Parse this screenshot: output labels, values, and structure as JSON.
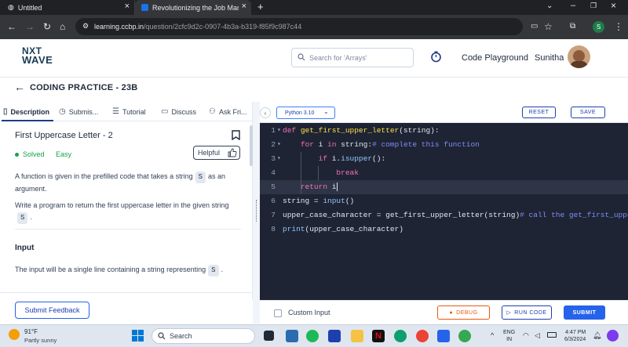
{
  "browser": {
    "tabs": [
      {
        "title": "Untitled"
      },
      {
        "title": "Revolutionizing the Job Market"
      }
    ],
    "url_host": "learning.ccbp.in",
    "url_path": "/question/2cfc9d2c-0907-4b3a-b319-f85f9c987c44",
    "profile_initial": "S"
  },
  "header": {
    "logo_line1": "NXT",
    "logo_line2": "WAVE",
    "search_placeholder": "Search for 'Arrays'",
    "code_playground": "Code Playground",
    "user_name": "Sunitha"
  },
  "page": {
    "title": "CODING PRACTICE - 23B"
  },
  "left_tabs": [
    {
      "label": "Description"
    },
    {
      "label": "Submis..."
    },
    {
      "label": "Tutorial"
    },
    {
      "label": "Discuss"
    },
    {
      "label": "Ask Fri..."
    }
  ],
  "problem": {
    "title": "First Uppercase Letter - 2",
    "status": "Solved",
    "difficulty": "Easy",
    "helpful_label": "Helpful",
    "p1_a": "A function is given in the prefilled code that takes a string",
    "p1_code": "S",
    "p1_b": "as an argument.",
    "p2_a": "Write a program to return the first uppercase letter in the given string",
    "p2_code": "S",
    "p2_b": ".",
    "input_heading": "Input",
    "input_a": "The input will be a single line containing a string representing",
    "input_code": "S",
    "input_b": ".",
    "submit_feedback": "Submit Feedback"
  },
  "editor": {
    "language": "Python 3.10",
    "reset_label": "RESET",
    "save_label": "SAVE",
    "lines": [
      {
        "num": "1",
        "segments": [
          [
            "kw",
            "def "
          ],
          [
            "fn",
            "get_first_upper_letter"
          ],
          [
            "",
            "(string):"
          ]
        ],
        "fold": "▾"
      },
      {
        "num": "2",
        "segments": [
          [
            "",
            "    "
          ],
          [
            "kw",
            "for "
          ],
          [
            "",
            "i "
          ],
          [
            "kw",
            "in "
          ],
          [
            "",
            "string:"
          ],
          [
            "cm",
            "# complete this function"
          ]
        ],
        "fold": "▾"
      },
      {
        "num": "3",
        "segments": [
          [
            "",
            "        "
          ],
          [
            "kw",
            "if "
          ],
          [
            "",
            "i."
          ],
          [
            "bi",
            "isupper"
          ],
          [
            "",
            "():"
          ]
        ],
        "fold": "▾"
      },
      {
        "num": "4",
        "segments": [
          [
            "",
            "            "
          ],
          [
            "kw",
            "break"
          ]
        ],
        "fold": ""
      },
      {
        "num": "5",
        "segments": [
          [
            "",
            "    "
          ],
          [
            "kw",
            "return "
          ],
          [
            "",
            "i"
          ]
        ],
        "fold": ""
      },
      {
        "num": "6",
        "segments": [
          [
            "",
            "string = "
          ],
          [
            "bi",
            "input"
          ],
          [
            "",
            "()"
          ]
        ],
        "fold": ""
      },
      {
        "num": "7",
        "segments": [
          [
            "",
            "upper_case_character = get_first_upper_letter(string)"
          ],
          [
            "cm",
            "# call the get_first_uppe"
          ]
        ],
        "fold": ""
      },
      {
        "num": "8",
        "segments": [
          [
            "bi",
            "print"
          ],
          [
            "",
            "(upper_case_character)"
          ]
        ],
        "fold": ""
      }
    ],
    "active_line": 5,
    "custom_input": "Custom Input",
    "debug_label": "DEBUG",
    "run_label": "RUN CODE",
    "submit_label": "SUBMIT"
  },
  "taskbar": {
    "temperature": "91°F",
    "weather": "Partly sunny",
    "search": "Search",
    "lang1": "ENG",
    "lang2": "IN",
    "time": "4:47 PM",
    "date": "6/3/2024"
  }
}
